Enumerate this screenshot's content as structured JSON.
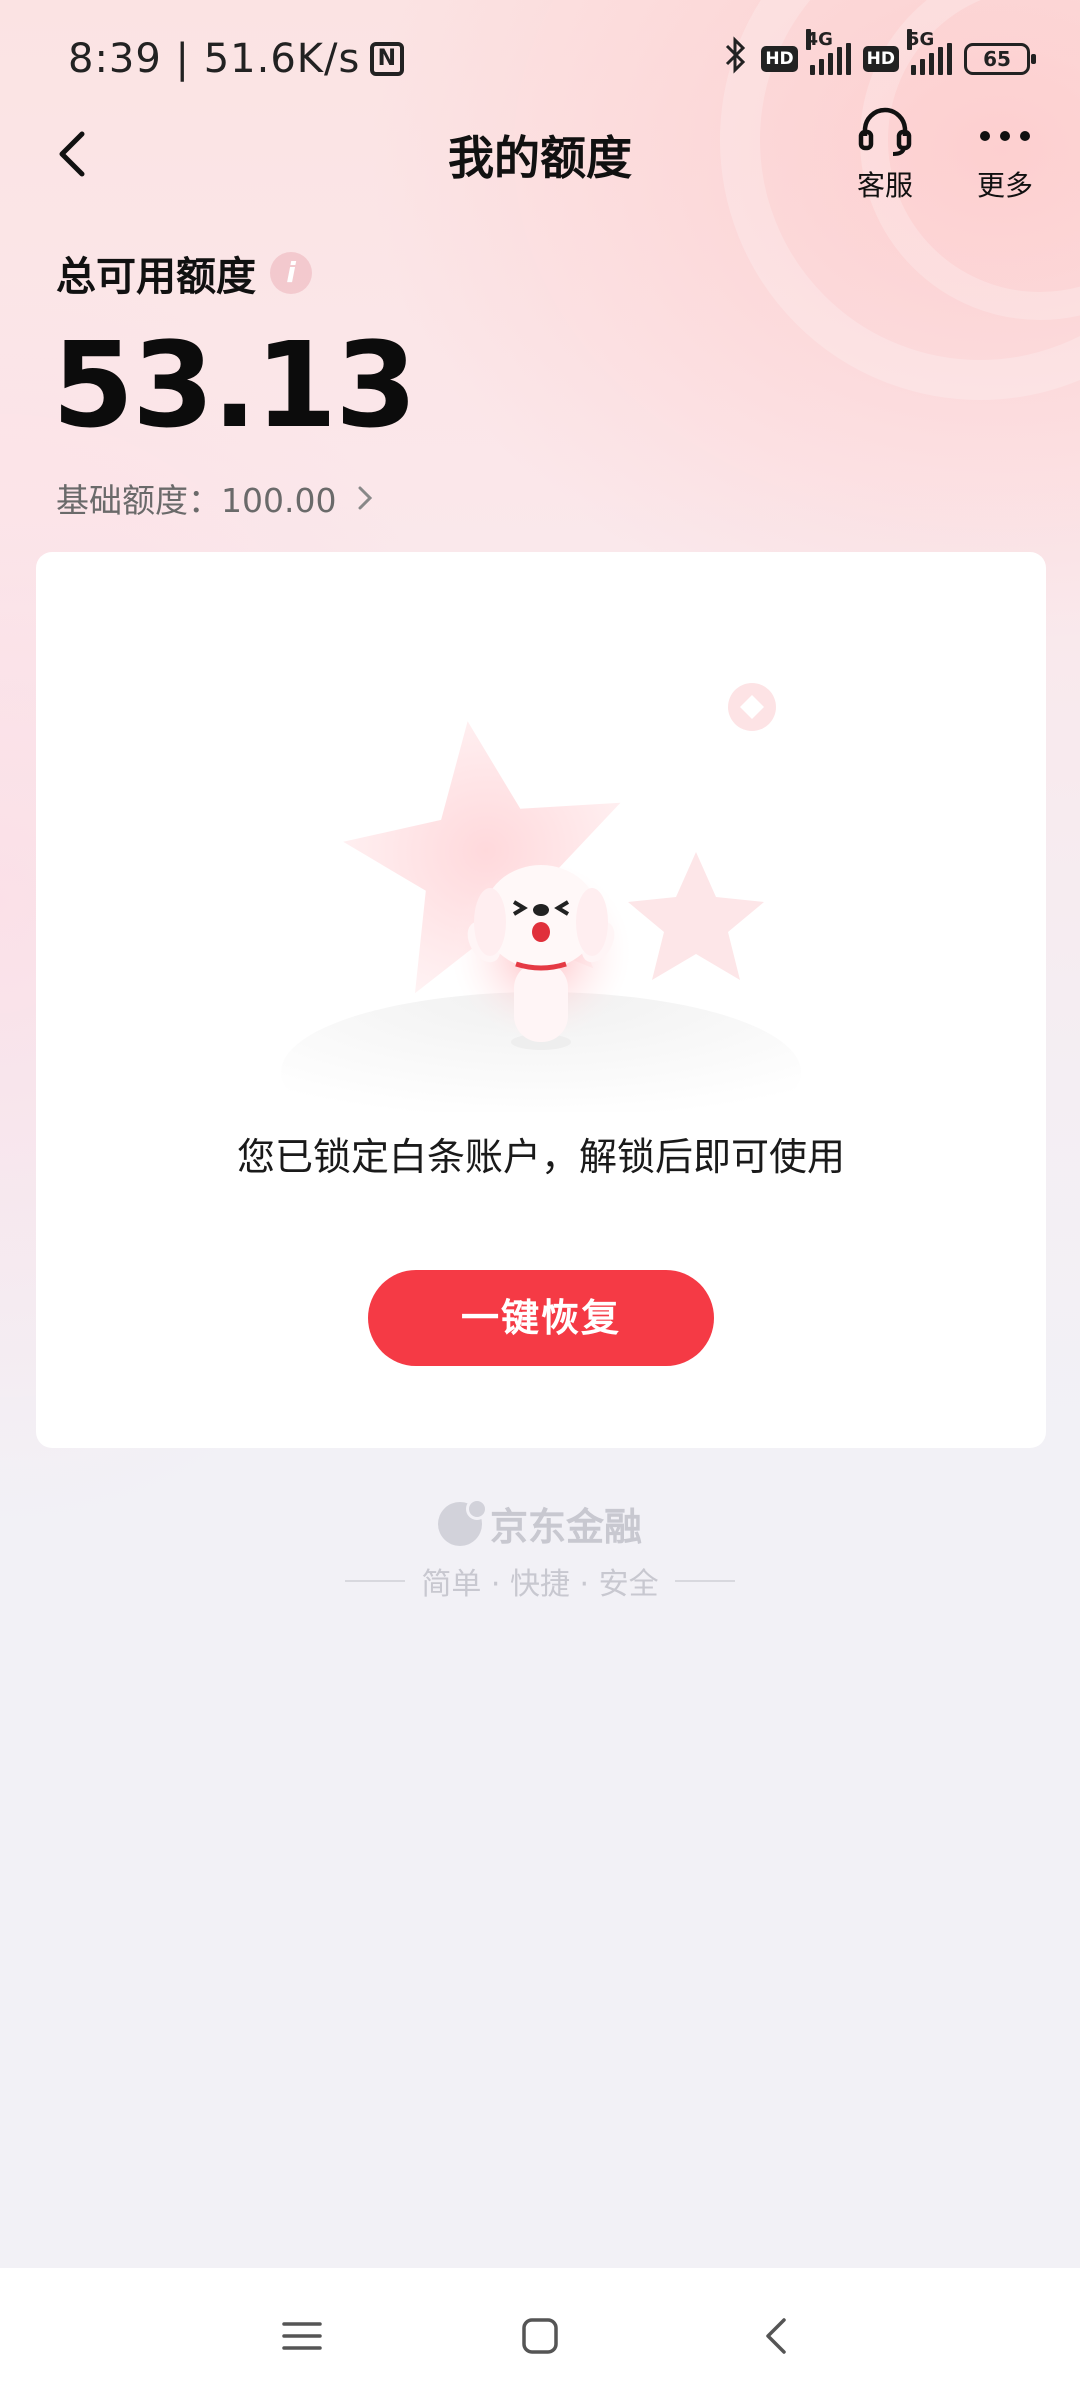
{
  "status_bar": {
    "time_speed": "8:39 | 51.6K/s",
    "nfc_label": "N",
    "hd1": "HD",
    "net1": "4G",
    "hd2": "HD",
    "net2": "5G",
    "battery": "65"
  },
  "nav": {
    "title": "我的额度",
    "service_label": "客服",
    "more_label": "更多"
  },
  "quota": {
    "label": "总可用额度",
    "info_icon": "i",
    "amount": "53.13",
    "base_label": "基础额度：100.00"
  },
  "card": {
    "message": "您已锁定白条账户，解锁后即可使用",
    "button_label": "一键恢复"
  },
  "brand": {
    "name": "京东金融",
    "slogan": "简单 · 快捷 · 安全"
  },
  "colors": {
    "accent": "#f53a45",
    "text_primary": "#111111",
    "text_secondary": "#6a6a6a",
    "brand_gray": "#c8c8d0"
  },
  "icons": {
    "back": "back-arrow-icon",
    "service": "headset-icon",
    "more": "more-dots-icon",
    "info": "info-icon",
    "chevron": "chevron-right-icon",
    "sys_menu": "menu-icon",
    "sys_home": "home-icon",
    "sys_back": "back-icon"
  }
}
